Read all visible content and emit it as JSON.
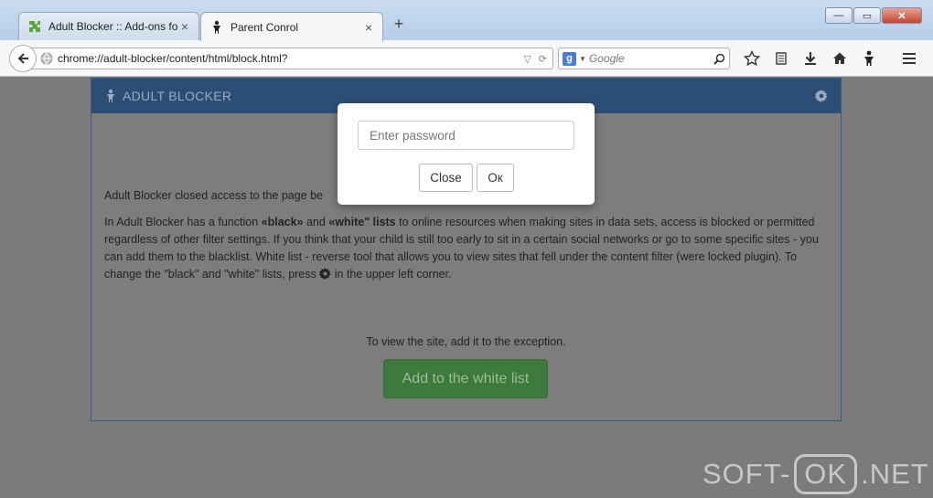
{
  "window": {
    "tabs": [
      {
        "label": "Adult Blocker :: Add-ons fo...",
        "close": "×",
        "active": false,
        "icon": "puzzle-icon"
      },
      {
        "label": "Parent Conrol",
        "close": "×",
        "active": true,
        "icon": "child-icon"
      }
    ],
    "new_tab": "+",
    "controls": {
      "minimize": "—",
      "maximize": "▭",
      "close": "✕"
    }
  },
  "navbar": {
    "url": "chrome://adult-blocker/content/html/block.html?",
    "search": {
      "engine": "g",
      "placeholder": "Google"
    }
  },
  "panel": {
    "title": "ADULT BLOCKER",
    "closed_text": "Adult Blocker closed access to the page be",
    "description": {
      "part1": "In Adult Blocker has a function ",
      "black": "«black»",
      "part2": " and ",
      "white": "«white\" lists",
      "part3": " to online resources when making sites in data sets, access is blocked or permitted regardless of other filter settings. If you think that your child is still too early to sit in a certain social networks or go to some specific sites - you can add them to the blacklist. White list - reverse tool that allows you to view sites that fell under the content filter (were locked plugin). To change the \"black\" and \"white\" lists, press ",
      "part4": " in the upper left corner."
    },
    "exception_text": "To view the site, add it to the exception.",
    "add_button": "Add to the white list"
  },
  "modal": {
    "password_placeholder": "Enter password",
    "close_button": "Close",
    "ok_button": "Ок"
  },
  "watermark": {
    "left": "SOFT-",
    "box": "OK",
    "right": ".NET"
  },
  "colors": {
    "header": "#2d4e74",
    "button_green": "#3e7a3c",
    "overlay": "#7b7b7b"
  }
}
